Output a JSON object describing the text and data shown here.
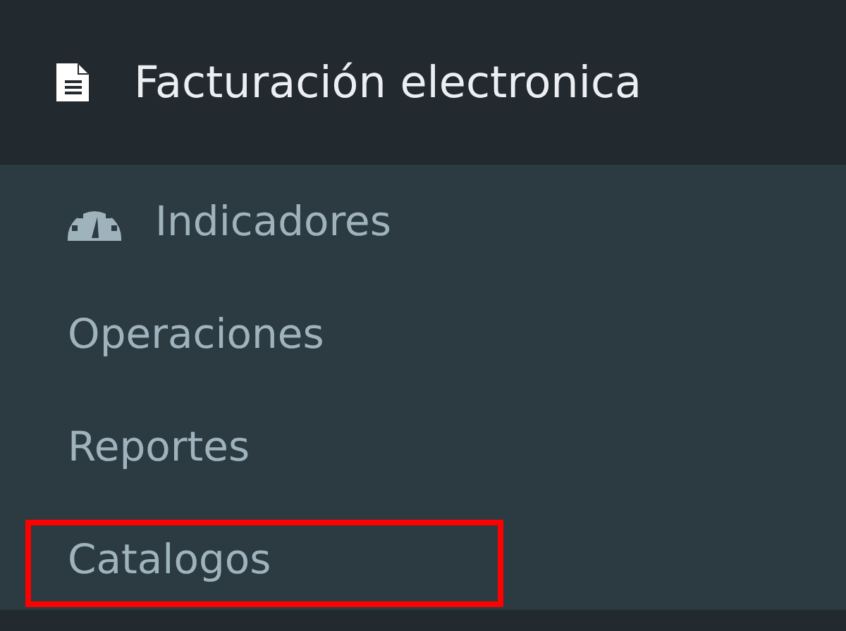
{
  "header": {
    "title": "Facturación electronica"
  },
  "menu_items": [
    {
      "label": "Indicadores",
      "kind": "icon",
      "highlighted": false
    },
    {
      "label": "Operaciones",
      "kind": "plain",
      "highlighted": false
    },
    {
      "label": "Reportes",
      "kind": "plain",
      "highlighted": false
    },
    {
      "label": "Catalogos",
      "kind": "plain",
      "highlighted": true
    }
  ]
}
